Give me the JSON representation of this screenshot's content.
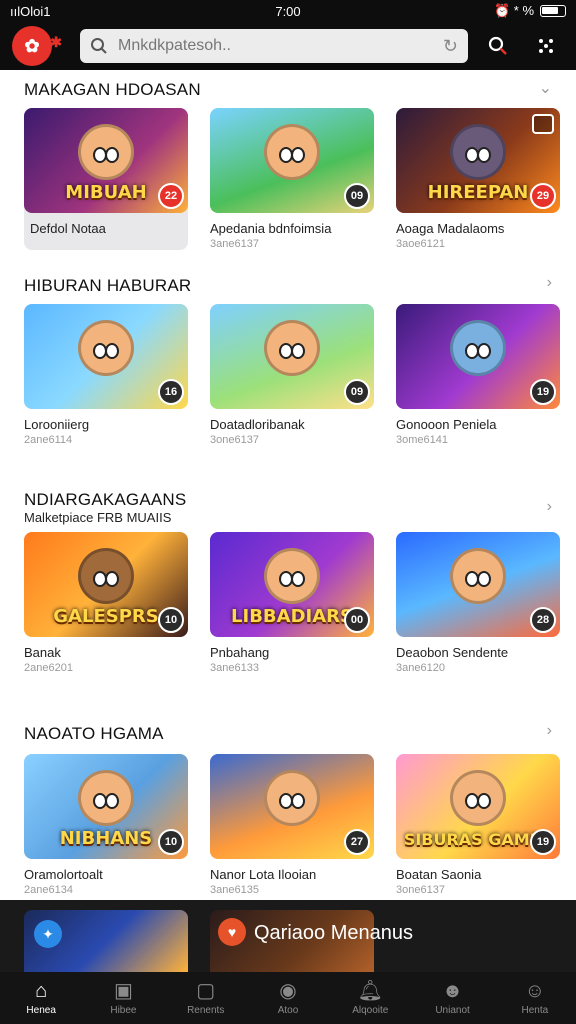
{
  "status_bar": {
    "carrier": "ıılOloi1",
    "time": "7:00",
    "right_icons": "⏰ * %"
  },
  "top_bar": {
    "search_placeholder": "Mnkdkpatesoh.."
  },
  "sections": [
    {
      "title": "MAKAGAN HDOASAN",
      "subtitle": "",
      "cards": [
        {
          "art_label": "MIBUAH",
          "badge": "22",
          "badge_color": "red",
          "title": "Defdol Notaa",
          "meta": "",
          "highlight": true
        },
        {
          "art_label": "",
          "badge": "09",
          "badge_color": "dark",
          "title": "Apedania bdnfoimsia",
          "meta": "3ane6137"
        },
        {
          "art_label": "HIREEPAN",
          "badge": "29",
          "badge_color": "red",
          "title": "Aoaga Madalaoms",
          "meta": "3aoe6121",
          "corner_icon": true
        }
      ]
    },
    {
      "title": "HIBURAN HABURAR",
      "subtitle": "",
      "cards": [
        {
          "art_label": "",
          "badge": "16",
          "badge_color": "dark",
          "title": "Lorooniierg",
          "meta": "2ane6114"
        },
        {
          "art_label": "",
          "badge": "09",
          "badge_color": "dark",
          "title": "Doatadloribanak",
          "meta": "3one6137"
        },
        {
          "art_label": "",
          "badge": "19",
          "badge_color": "dark",
          "title": "Gonooon Peniela",
          "meta": "3ome6141"
        }
      ]
    },
    {
      "title": "NDIARGAKAGAANS",
      "subtitle": "Malketpiace FRB MUAIIS",
      "cards": [
        {
          "art_label": "GALESPRS",
          "badge": "10",
          "badge_color": "dark",
          "title": "Banak",
          "meta": "2ane6201"
        },
        {
          "art_label": "LIBBADIARS",
          "badge": "00",
          "badge_color": "dark",
          "title": "Pnbahang",
          "meta": "3ane6133"
        },
        {
          "art_label": "",
          "badge": "28",
          "badge_color": "dark",
          "title": "Deaobon Sendente",
          "meta": "3ane6120"
        }
      ]
    },
    {
      "title": "NAOATO HGAMA",
      "subtitle": "",
      "cards": [
        {
          "art_label": "NIBHANS",
          "badge": "10",
          "badge_color": "dark",
          "title": "Oramolortoalt",
          "meta": "2ane6134"
        },
        {
          "art_label": "",
          "badge": "27",
          "badge_color": "dark",
          "title": "Nanor Lota Ilooian",
          "meta": "3ane6135"
        },
        {
          "art_label": "SIBURAS GAMES",
          "badge": "19",
          "badge_color": "dark",
          "title": "Boatan Saonia",
          "meta": "3one6137"
        }
      ]
    }
  ],
  "mini_player": {
    "title": "Qariaoo Menanus"
  },
  "tabs": [
    {
      "icon": "home-icon",
      "label": "Henea",
      "active": true
    },
    {
      "icon": "box-icon",
      "label": "Hibee",
      "active": false
    },
    {
      "icon": "square-icon",
      "label": "Renents",
      "active": false
    },
    {
      "icon": "compass-icon",
      "label": "Atoo",
      "active": false
    },
    {
      "icon": "bell-icon",
      "label": "Alqooite",
      "active": false
    },
    {
      "icon": "people-icon",
      "label": "Unianot",
      "active": false
    },
    {
      "icon": "profile-icon",
      "label": "Henta",
      "active": false
    }
  ]
}
